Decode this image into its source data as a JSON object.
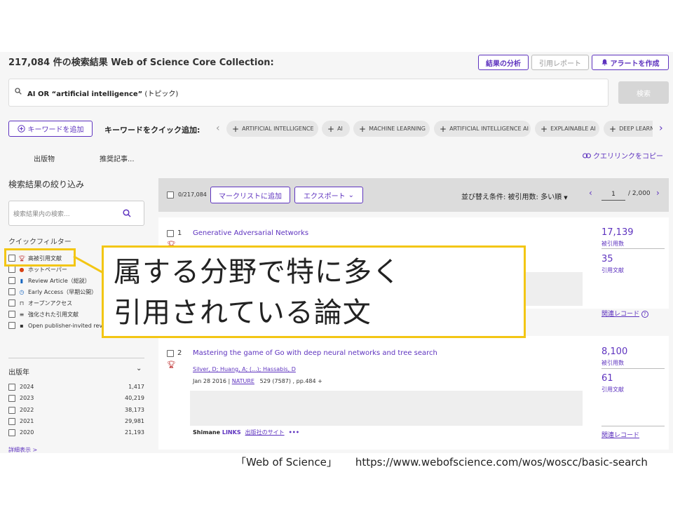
{
  "header": {
    "result_title": "217,084 件の検索結果 Web of Science Core Collection:",
    "analyze_button": "結果の分析",
    "citation_report_button": "引用レポート",
    "alert_button": "アラートを作成"
  },
  "search": {
    "query_bold": "AI OR “artificial intelligence”",
    "query_field": " (トピック)",
    "search_button": "検索"
  },
  "keywords": {
    "add_button": "キーワードを追加",
    "quick_add_label": "キーワードをクイック追加:",
    "chips": [
      "ARTIFICIAL INTELLIGENCE",
      "AI",
      "MACHINE LEARNING",
      "ARTIFICIAL INTELLIGENCE AI",
      "EXPLAINABLE AI",
      "DEEP LEARN"
    ]
  },
  "tabs": {
    "publications": "出版物",
    "recommended": "推奨記事...",
    "copy_query_link": "クエリリンクをコピー"
  },
  "sidebar": {
    "title": "検索結果の絞り込み",
    "search_placeholder": "検索結果内の検索...",
    "quick_filter_title": "クイックフィルター",
    "quick_filters": [
      {
        "label": "高被引用文献",
        "icon": "trophy-icon"
      },
      {
        "label": "ホットペーパー",
        "icon": "fire-icon"
      },
      {
        "label": "Review Article（総説）",
        "icon": "document-icon"
      },
      {
        "label": "Early Access（早期公開）",
        "icon": "clock-icon"
      },
      {
        "label": "オープンアクセス",
        "icon": "lock-open-icon"
      },
      {
        "label": "強化された引用文献",
        "icon": "list-icon"
      },
      {
        "label": "Open publisher-invited revi",
        "icon": "comment-icon"
      }
    ],
    "pub_year_title": "出版年",
    "years": [
      {
        "year": "2024",
        "count": "1,417"
      },
      {
        "year": "2023",
        "count": "40,219"
      },
      {
        "year": "2022",
        "count": "38,173"
      },
      {
        "year": "2021",
        "count": "29,981"
      },
      {
        "year": "2020",
        "count": "21,193"
      }
    ],
    "more_link": "詳細表示 >"
  },
  "toolbar": {
    "selected_count": "0/217,084",
    "add_marked_list": "マークリストに追加",
    "export": "エクスポート",
    "sort_label": "並び替え条件: 被引用数: 多い順",
    "page_current": "1",
    "page_total": "/ 2,000"
  },
  "results": [
    {
      "num": "1",
      "title": "Generative Adversarial Networks",
      "times_cited": "17,139",
      "times_cited_label": "被引用数",
      "references": "35",
      "references_label": "引用文献",
      "related": "関連レコード"
    },
    {
      "num": "2",
      "title": "Mastering the game of Go with deep neural networks and tree search",
      "authors": "Silver, D; Huang, A; (...); Hassabis, D",
      "date": "Jan 28 2016 | ",
      "journal": "NATURE",
      "volume": "529 (7587) , pp.484 +",
      "times_cited": "8,100",
      "times_cited_label": "被引用数",
      "references": "61",
      "references_label": "引用文献",
      "links_brand": "Shimane",
      "links_brand_suffix": "LINKS",
      "publisher_site": "出版社のサイト",
      "more": "•••",
      "related": "関連レコード"
    }
  ],
  "callout": {
    "line1": "属する分野で特に多く",
    "line2": "引用されている論文"
  },
  "caption": {
    "source": "「Web of Science」",
    "url": "https://www.webofscience.com/wos/woscc/basic-search"
  },
  "colors": {
    "accent": "#5e33bf",
    "highlight": "#f3c614",
    "trophy": "#b71c1c"
  }
}
